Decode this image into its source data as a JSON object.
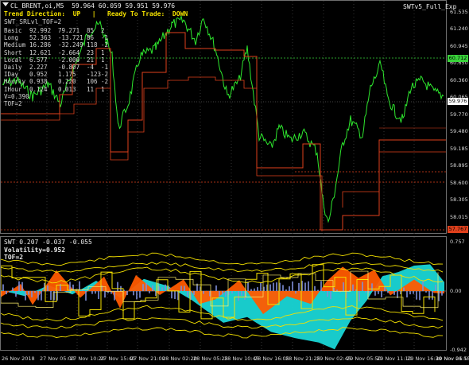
{
  "header": {
    "symbol_line": "CL_BRENT,oi,M5  59.964 60.059 59.951 59.976",
    "direction_line": "Trend Direction:  UP   |   Ready To Trade:  DOWN",
    "indicator_label": "SWT_SRLvl_TOF=2",
    "expert_label": "SWTv5_Full_Exp"
  },
  "table": {
    "rows": [
      [
        "Basic",
        "92.992",
        "79.271",
        "85",
        "2"
      ],
      [
        "Long",
        "52.363",
        "-13.721",
        "86",
        "-1"
      ],
      [
        "Medium",
        "16.286",
        "-32.249",
        "118",
        "-2"
      ],
      [
        "Short",
        "12.621",
        "-2.664",
        "23",
        "1"
      ],
      [
        "Local",
        "6.577",
        "-2.000",
        "21",
        "1"
      ],
      [
        "Daily",
        "2.227",
        "-0.807",
        "-4",
        "-1"
      ],
      [
        "IDay",
        "0.952",
        "1.175",
        "-123",
        "-2"
      ],
      [
        "Hourly",
        "0.938",
        "0.220",
        "106",
        "-2"
      ],
      [
        "IHour",
        "0.124",
        "0.013",
        "11",
        "1"
      ]
    ],
    "v_line": "V=0.390",
    "tof_line": "TOF=2"
  },
  "price_axis": {
    "labels": [
      "61.535",
      "61.240",
      "60.945",
      "60.650",
      "60.360",
      "60.065",
      "59.770",
      "59.480",
      "59.185",
      "58.895",
      "58.600",
      "58.305",
      "58.015"
    ],
    "tag_green": "60.712",
    "tag_current": "59.976",
    "tag_red": "57.767"
  },
  "sub_window": {
    "title": "SWT 0.207 -0.037 -0.055",
    "volatility": "Volatility=0.952",
    "tof": "TOF=2",
    "axis_top": "0.757",
    "axis_zero": "0.00",
    "axis_bottom": "-0.942"
  },
  "time_axis": [
    "26 Nov 2018",
    "27 Nov 05:00",
    "27 Nov 10:20",
    "27 Nov 15:40",
    "27 Nov 21:00",
    "28 Nov 02:20",
    "28 Nov 05:25",
    "28 Nov 10:45",
    "28 Nov 16:05",
    "28 Nov 21:25",
    "29 Nov 02:45",
    "29 Nov 05:50",
    "29 Nov 11:10",
    "29 Nov 16:30",
    "29 Nov 21:50",
    "30 Nov 06:15"
  ],
  "colors": {
    "candles": "#2ee82e",
    "levels": "#e0401c",
    "swt_orange": "#ff5a00",
    "swt_cyan": "#19d6d6",
    "swt_yellow": "#f3e000",
    "hist_blue": "#7f8fd8"
  }
}
